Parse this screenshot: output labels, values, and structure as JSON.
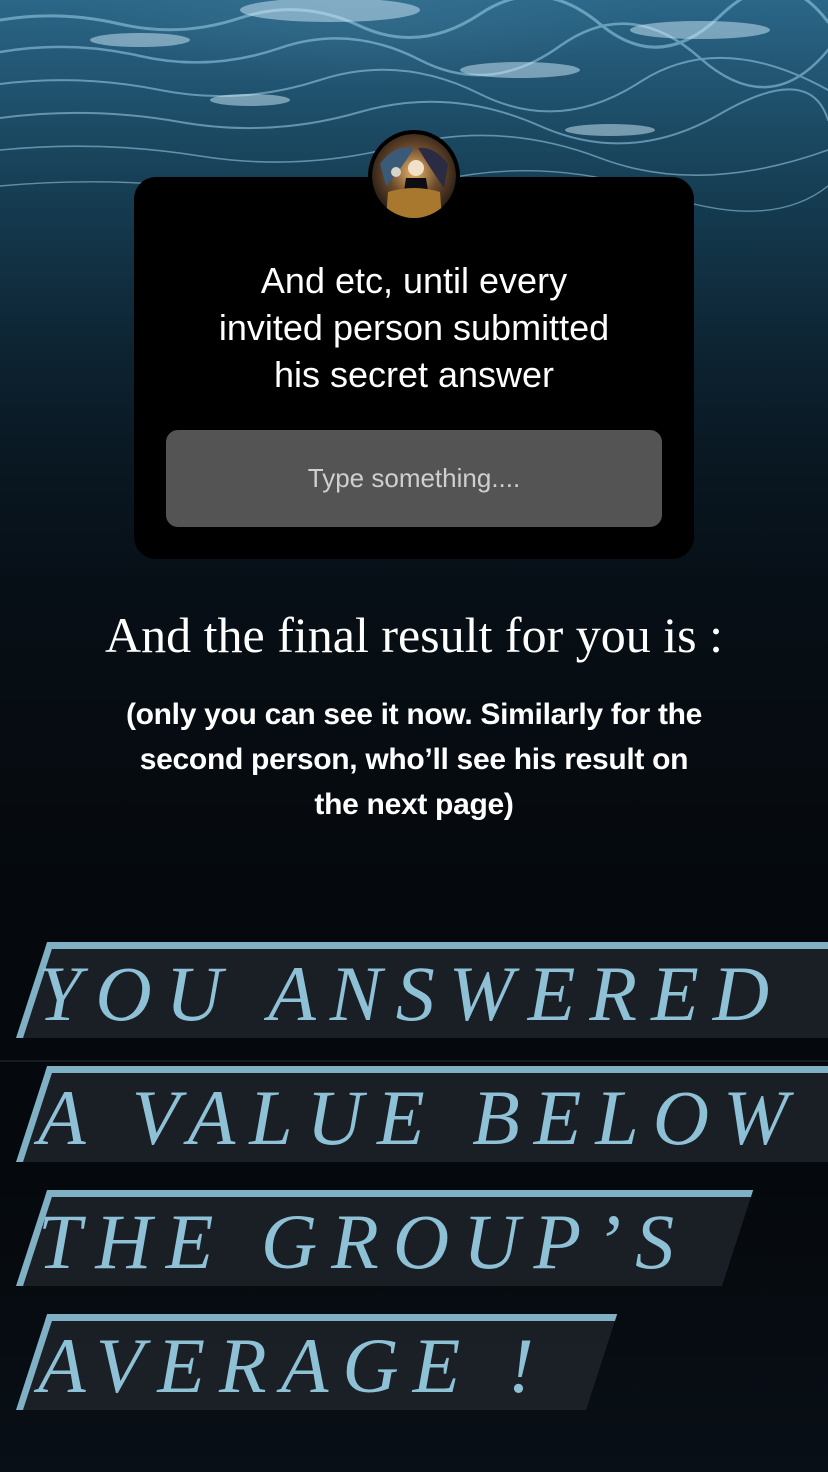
{
  "question_sticker": {
    "text": "And etc, until every invited person submitted his secret answer",
    "placeholder": "Type something...."
  },
  "headline": "And the final result for you is :",
  "subnote": "(only you can see it now. Similarly for the second person, who’ll see his result on the next page)",
  "result_lines": [
    "YOU ANSWERED",
    "A VALUE BELOW",
    "THE GROUP’S",
    "AVERAGE !"
  ],
  "colors": {
    "sticker_background": "#000000",
    "input_background": "#545454",
    "banner_text": "#8ec0d6",
    "banner_stripe": "#7fb0c4"
  },
  "icons": {
    "avatar": "profile-avatar-icon"
  }
}
